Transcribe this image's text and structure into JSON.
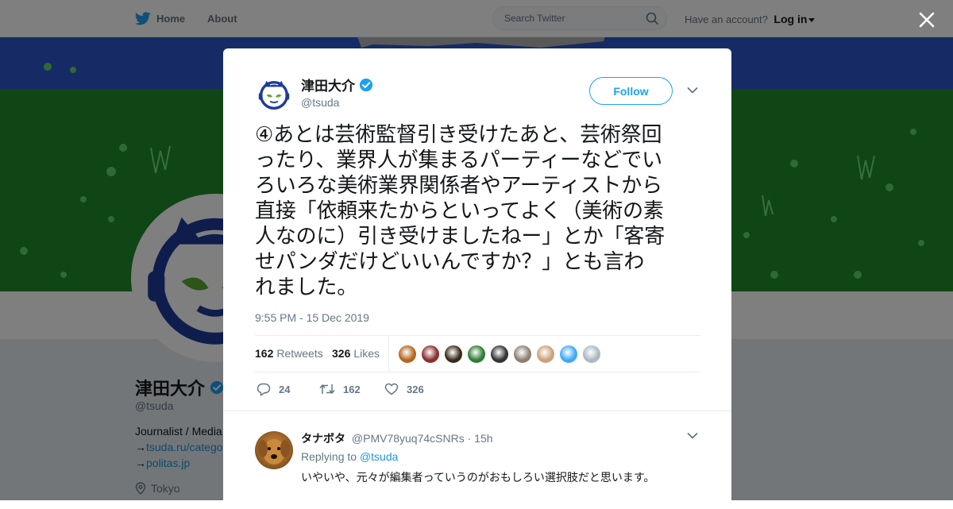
{
  "topnav": {
    "home_label": "Home",
    "about_label": "About",
    "search_placeholder": "Search Twitter",
    "account_prompt": "Have an account?",
    "login_label": "Log in"
  },
  "profile": {
    "name": "津田大介",
    "handle": "@tsuda",
    "bio": "Journalist / Media",
    "link1": "tsuda.ru/catego",
    "link2": "politas.jp",
    "link_arrow": "→",
    "location": "Tokyo"
  },
  "tweet": {
    "author_name": "津田大介",
    "author_handle": "@tsuda",
    "follow_label": "Follow",
    "text_lines": [
      "④あとは芸術監督引き受けたあと、芸術祭回",
      "ったり、業界人が集まるパーティーなどでい",
      "ろいろな美術業界関係者やアーティストから",
      "直接「依頼来たからといってよく（美術の素",
      "人なのに）引き受けましたねー」とか「客寄",
      "せパンダだけどいいんですか？」とも言わ",
      "れました。"
    ],
    "timestamp": "9:55 PM - 15 Dec 2019",
    "retweets_count": "162",
    "retweets_label": "Retweets",
    "likes_count": "326",
    "likes_label": "Likes",
    "replies_action_count": "24",
    "retweet_action_count": "162",
    "like_action_count": "326",
    "liker_colors": [
      "#b5651d",
      "#8b2e2e",
      "#3a2a1a",
      "#2e7d32",
      "#333333",
      "#8d8070",
      "#c9a27a",
      "#3fa9f5",
      "#aab8c2"
    ]
  },
  "reply": {
    "name": "タナボタ",
    "handle": "@PMV78yuq74cSNRs",
    "separator": "·",
    "time": "15h",
    "replying_to_label": "Replying to",
    "replying_to_handle": "@tsuda",
    "text": "いやいや、元々が編集者っていうのがおもしろい選択肢だと思います。"
  },
  "colors": {
    "twitter_blue": "#1da1f2",
    "link_blue": "#1b95e0",
    "verified_blue": "#1da1f2",
    "napster_navy": "#1e3a9a",
    "napster_green": "#5aa832",
    "banner_blue": "#2d57cc",
    "banner_green": "#218a2b"
  },
  "icons": {
    "logo": "twitter-bird-icon",
    "search": "search-icon",
    "close": "close-icon",
    "verified": "verified-badge-icon",
    "reply": "reply-icon",
    "retweet": "retweet-icon",
    "like": "heart-icon",
    "chevron": "chevron-down-icon",
    "location": "location-pin-icon"
  }
}
